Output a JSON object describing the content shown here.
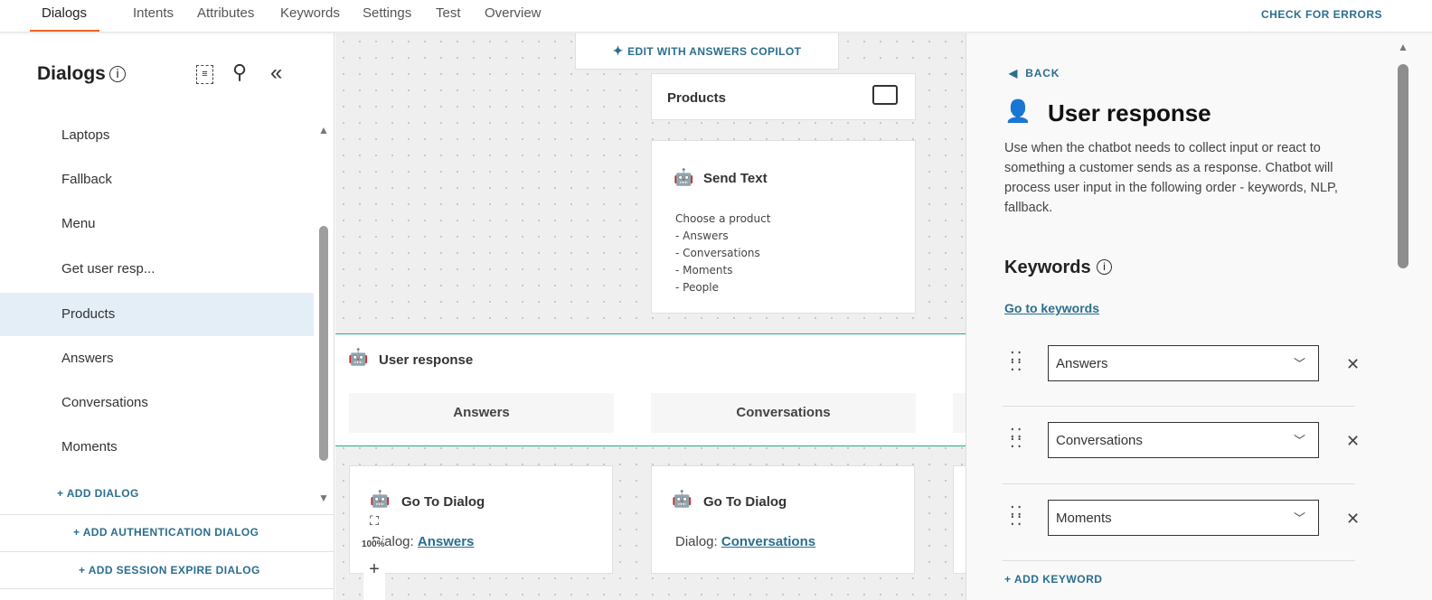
{
  "topbar": {
    "tabs": [
      "Dialogs",
      "Intents",
      "Attributes",
      "Keywords",
      "Settings",
      "Test",
      "Overview"
    ],
    "check_errors": "CHECK FOR ERRORS",
    "accent": "#f26522"
  },
  "sidebar": {
    "title": "Dialogs",
    "items": [
      "Laptops",
      "Fallback",
      "Menu",
      "Get user resp...",
      "Products",
      "Answers",
      "Conversations",
      "Moments"
    ],
    "selected": "Products",
    "add_dialog": "+ ADD DIALOG",
    "add_auth": "+ ADD AUTHENTICATION DIALOG",
    "add_session": "+ ADD SESSION EXPIRE DIALOG"
  },
  "canvas": {
    "copilot": "EDIT WITH ANSWERS COPILOT",
    "products_title": "Products",
    "send_text_title": "Send Text",
    "send_text_lines": [
      "Choose a product",
      "- Answers",
      "- Conversations",
      "- Moments",
      "- People"
    ],
    "user_response_title": "User response",
    "options": [
      "Answers",
      "Conversations"
    ],
    "goto_title": "Go To Dialog",
    "goto_label": "Dialog:",
    "goto_targets": [
      "Answers",
      "Conversations"
    ],
    "zoom": "100%",
    "zoom_in": "+"
  },
  "panel": {
    "back": "BACK",
    "title": "User response",
    "description": "Use when the chatbot needs to collect input or react to something a customer sends as a response. Chatbot will process user input in the following order - keywords, NLP, fallback.",
    "keywords_heading": "Keywords",
    "go_to_keywords": "Go to keywords",
    "keywords": [
      "Answers",
      "Conversations",
      "Moments"
    ],
    "add_keyword": "+ ADD KEYWORD",
    "link_color": "#2b6e8f"
  }
}
